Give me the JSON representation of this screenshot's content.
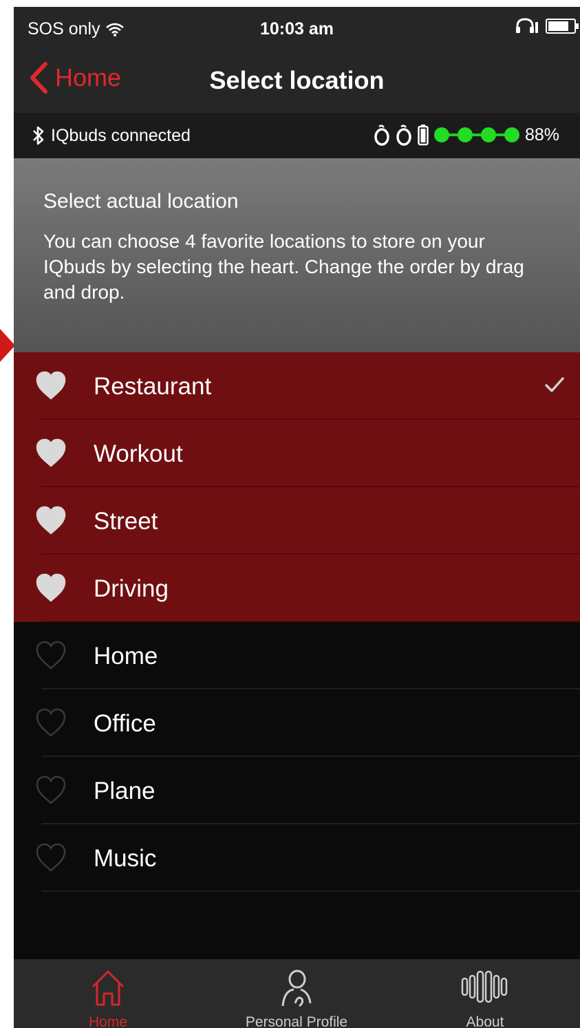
{
  "status_bar": {
    "carrier": "SOS only",
    "time": "10:03 am",
    "battery_level": 0.8
  },
  "nav": {
    "back_label": "Home",
    "title": "Select location"
  },
  "connection": {
    "status": "IQbuds connected",
    "battery_percent": "88%",
    "level_dots": 4
  },
  "info": {
    "title": "Select actual location",
    "text": "You can choose 4 favorite locations to store on your IQbuds by selecting the heart. Change the order by drag and drop."
  },
  "locations": [
    {
      "label": "Restaurant",
      "favorite": true,
      "selected": true
    },
    {
      "label": "Workout",
      "favorite": true,
      "selected": false
    },
    {
      "label": "Street",
      "favorite": true,
      "selected": false
    },
    {
      "label": "Driving",
      "favorite": true,
      "selected": false
    },
    {
      "label": "Home",
      "favorite": false,
      "selected": false
    },
    {
      "label": "Office",
      "favorite": false,
      "selected": false
    },
    {
      "label": "Plane",
      "favorite": false,
      "selected": false
    },
    {
      "label": "Music",
      "favorite": false,
      "selected": false
    }
  ],
  "tabs": [
    {
      "label": "Home",
      "icon": "home-icon",
      "active": true
    },
    {
      "label": "Personal Profile",
      "icon": "profile-icon",
      "active": false
    },
    {
      "label": "About",
      "icon": "about-icon",
      "active": false
    }
  ],
  "colors": {
    "accent": "#e0282b",
    "favorite_row": "#700f12",
    "level_green": "#22dd22"
  }
}
